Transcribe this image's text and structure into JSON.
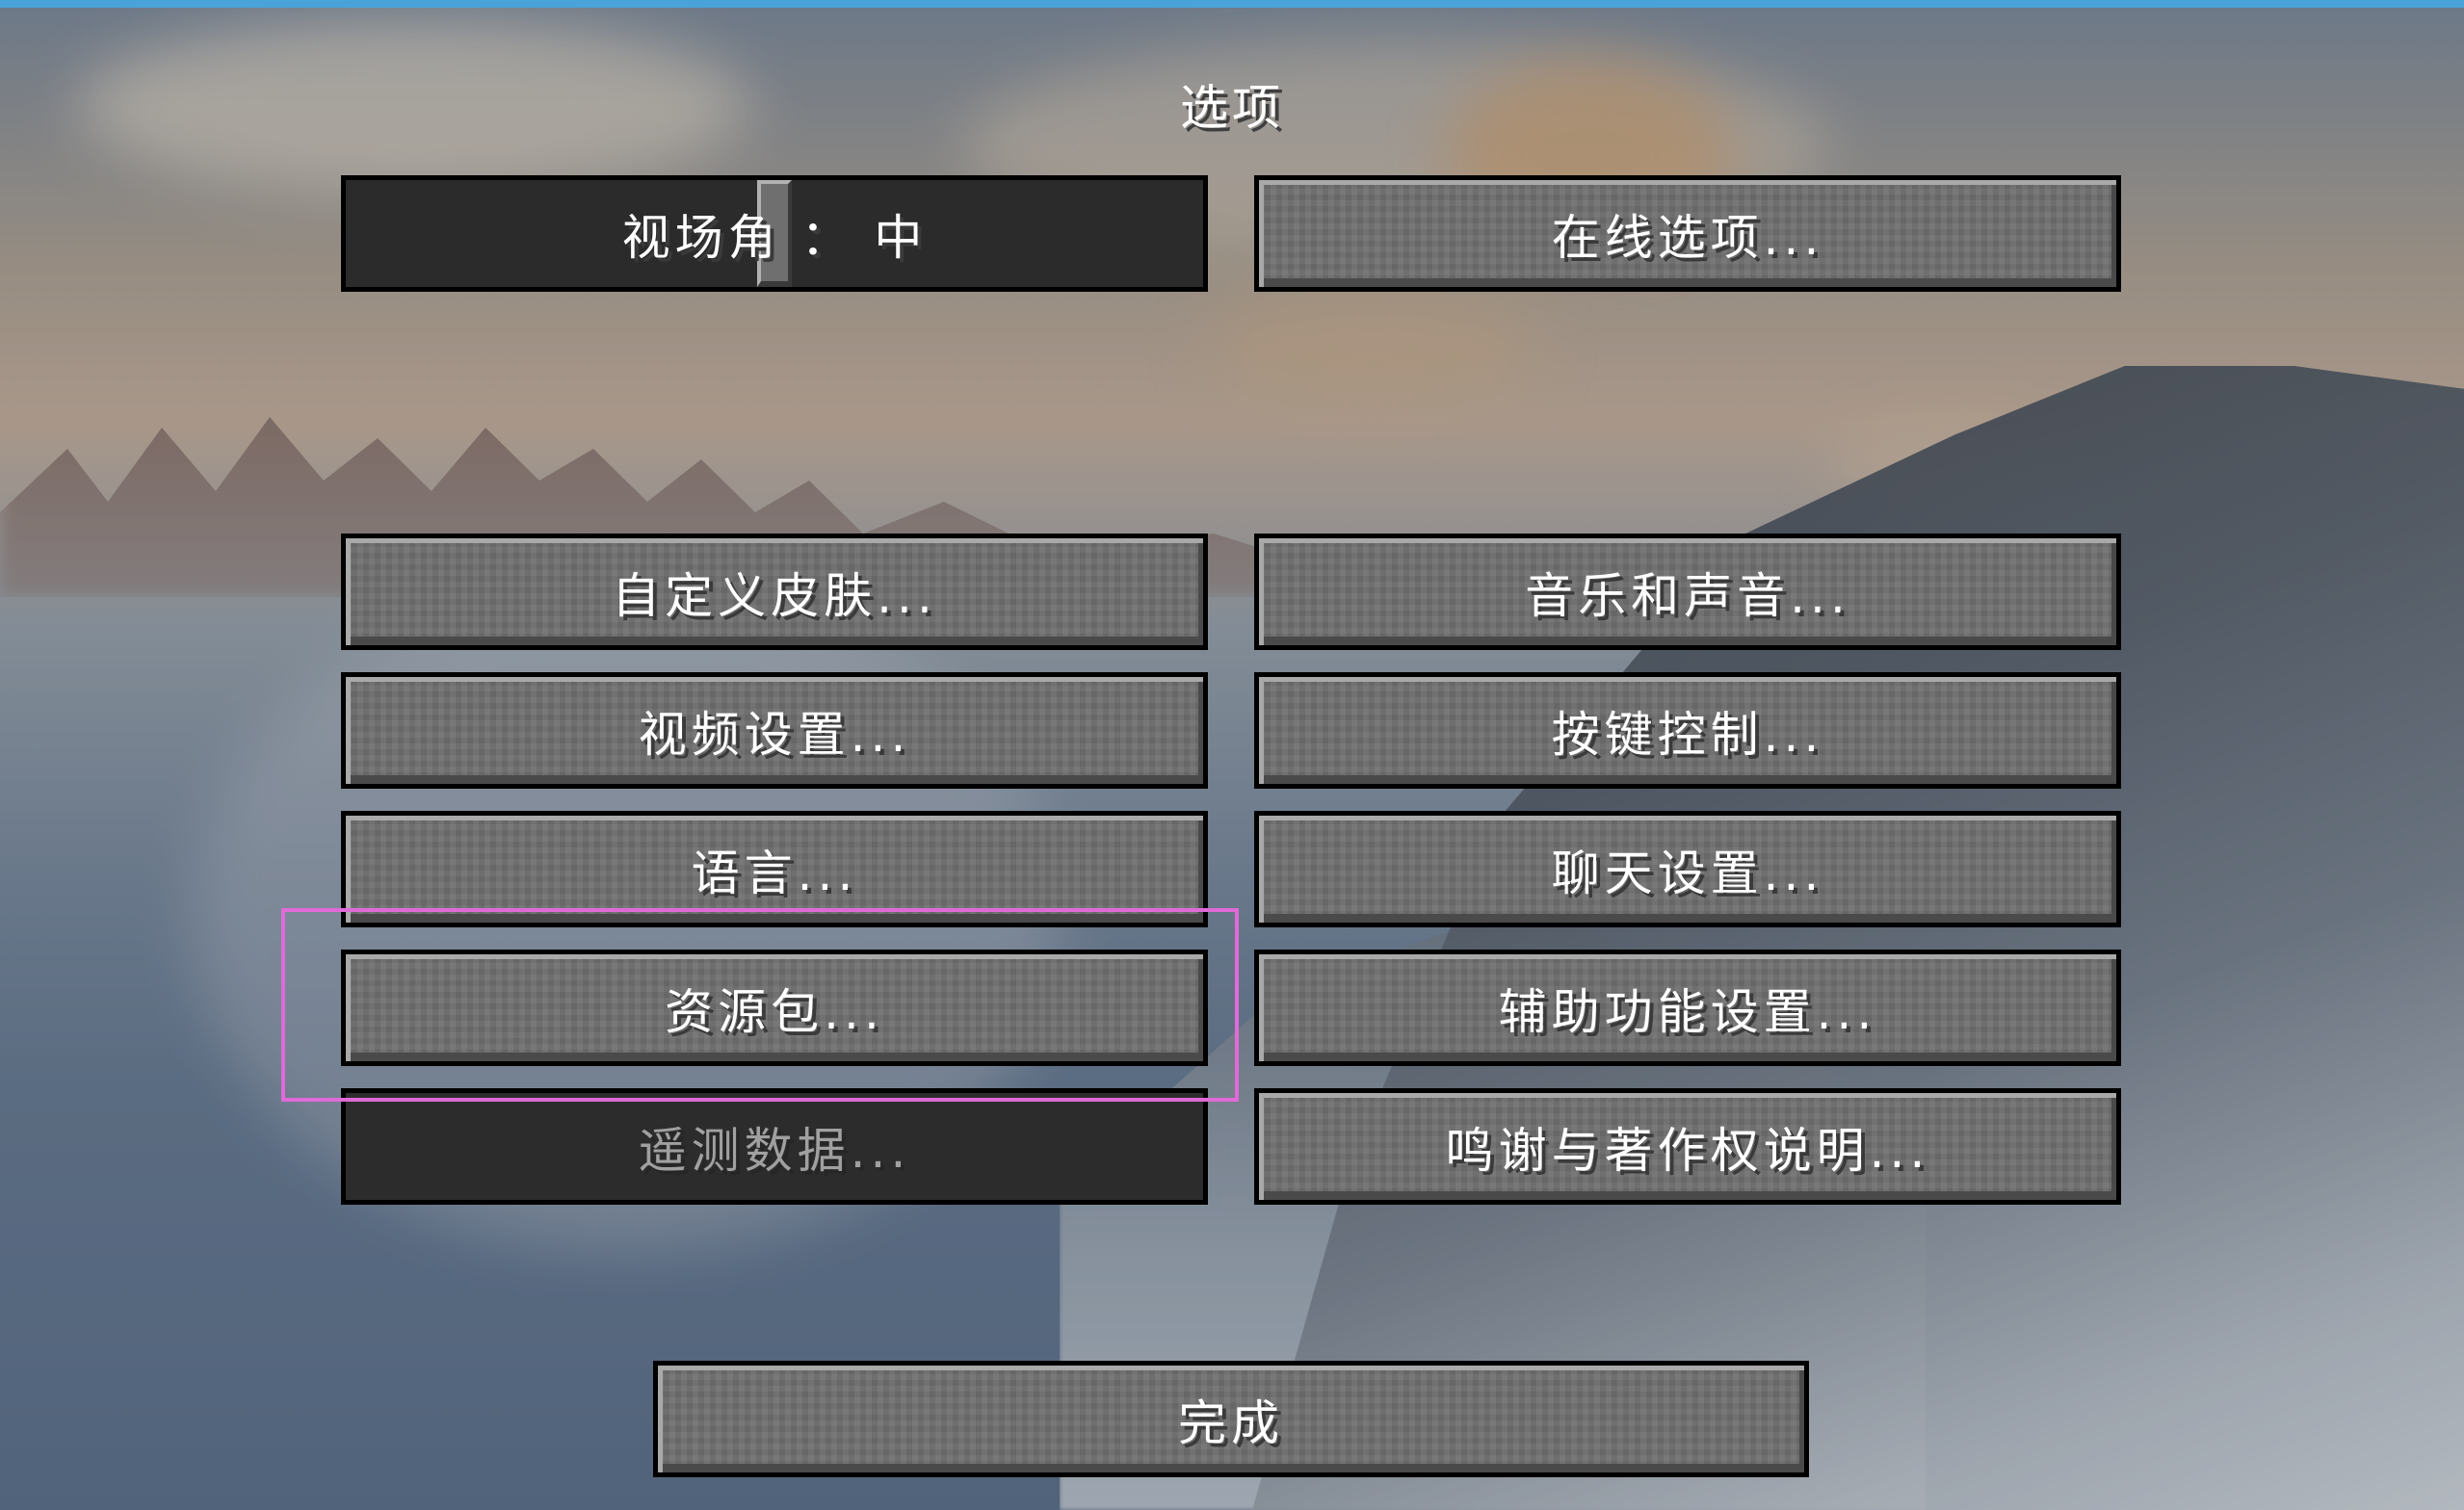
{
  "screen": {
    "title": "选项"
  },
  "fov_slider": {
    "label": "视场角",
    "separator": "：",
    "value": "中",
    "level": 0.5
  },
  "buttons": {
    "online": "在线选项...",
    "skin": "自定义皮肤...",
    "music": "音乐和声音...",
    "video": "视频设置...",
    "controls": "按键控制...",
    "language": "语言...",
    "chat": "聊天设置...",
    "resource_packs": "资源包...",
    "accessibility": "辅助功能设置...",
    "telemetry": "遥测数据...",
    "credits": "鸣谢与著作权说明...",
    "done": "完成"
  },
  "states": {
    "telemetry_disabled": true
  },
  "colors": {
    "highlight": "#e06ad8",
    "topbar": "#4aa3d8",
    "button": "#6f6f6f",
    "button_disabled": "#2c2c2c"
  }
}
